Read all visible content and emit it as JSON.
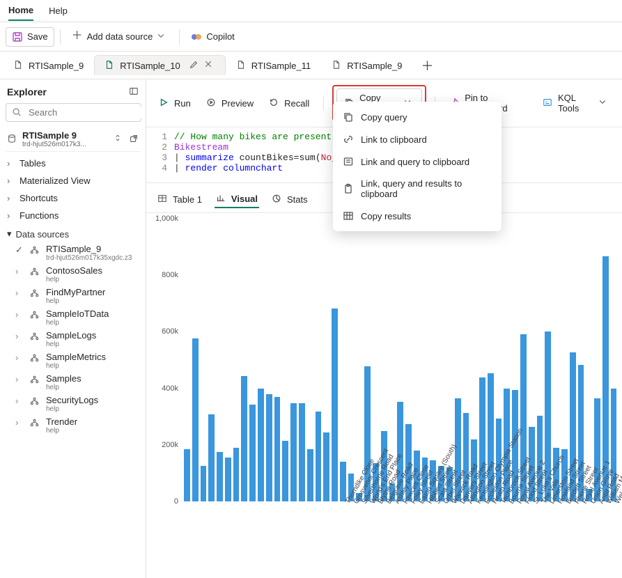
{
  "menu": {
    "home": "Home",
    "help": "Help"
  },
  "toolbar": {
    "save": "Save",
    "add_source": "Add data source",
    "copilot": "Copilot"
  },
  "tabs": [
    {
      "label": "RTISample_9"
    },
    {
      "label": "RTISample_10",
      "active": true
    },
    {
      "label": "RTISample_11"
    },
    {
      "label": "RTISample_9"
    }
  ],
  "actions": {
    "run": "Run",
    "preview": "Preview",
    "recall": "Recall",
    "copy": "Copy query",
    "pin": "Pin to dashboard",
    "kql": "KQL Tools"
  },
  "copy_menu": {
    "copy_query": "Copy query",
    "link": "Link to clipboard",
    "link_query": "Link and query to clipboard",
    "link_query_results": "Link, query and results to clipboard",
    "copy_results": "Copy results"
  },
  "editor": {
    "lines": [
      "1",
      "2",
      "3",
      "4"
    ],
    "line1_comment": "// How many bikes are present",
    "line2_ident": "Bikestream",
    "line3_pipe": "| ",
    "line3_op": "summarize",
    "line3_rest": " countBikes=sum(",
    "line3_col": "No_",
    "line4_pipe": "| ",
    "line4_op": "render",
    "line4_rest": " columnchart"
  },
  "sidebar": {
    "title": "Explorer",
    "search_ph": "Search",
    "db": {
      "name": "RTISample 9",
      "sub": "trd-hjut526m017k3..."
    },
    "sections": [
      "Tables",
      "Materialized View",
      "Shortcuts",
      "Functions"
    ],
    "ds_title": "Data sources",
    "ds": [
      {
        "name": "RTISample_9",
        "sub": "trd-hjut526m017k35xgdc.z3",
        "checked": true
      },
      {
        "name": "ContosoSales",
        "sub": "help"
      },
      {
        "name": "FindMyPartner",
        "sub": "help"
      },
      {
        "name": "SampleIoTData",
        "sub": "help"
      },
      {
        "name": "SampleLogs",
        "sub": "help"
      },
      {
        "name": "SampleMetrics",
        "sub": "help"
      },
      {
        "name": "Samples",
        "sub": "help"
      },
      {
        "name": "SecurityLogs",
        "sub": "help"
      },
      {
        "name": "Trender",
        "sub": "help"
      }
    ]
  },
  "result_tabs": {
    "table": "Table 1",
    "visual": "Visual",
    "stats": "Stats"
  },
  "chart_data": {
    "type": "bar",
    "ylabel": "",
    "xlabel": "",
    "ylim": [
      0,
      1000000
    ],
    "yticks": [
      "0",
      "200k",
      "400k",
      "600k",
      "800k",
      "1,000k"
    ],
    "categories": [
      "Thorndike Close",
      "Grosvenor Crescent",
      "Silverthorne Road",
      "World's End Place",
      "Blythe Road",
      "Belgrave Road",
      "Ashley Place",
      "Fawcett Close",
      "Foley Street",
      "Eaton Square (South)",
      "Hibbert Street",
      "Scala Street",
      "Orbel Street",
      "Warwick Road",
      "Danvers Street",
      "Allington Street",
      "Kensington Olympia Station",
      "Eccleston Place",
      "Heath Road",
      "Tachbrook Street",
      "Bourne Street",
      "Royal Avenue 2",
      "Flood Street",
      "St. Luke's Church",
      "The Vale",
      "Limerston Street",
      "Howland Street",
      "Burdett Street",
      "Phene Street",
      "Royal Avenue 1",
      "Union Grove",
      "Antill Road",
      "William Mor",
      "Wel"
    ],
    "values": [
      190000,
      590000,
      130000,
      315000,
      180000,
      160000,
      195000,
      455000,
      350000,
      410000,
      390000,
      380000,
      220000,
      355000,
      355000,
      190000,
      325000,
      250000,
      700000,
      145000,
      100000,
      30000,
      490000,
      140000,
      255000,
      65000,
      360000,
      280000,
      185000,
      160000,
      150000,
      130000,
      125000,
      375000,
      320000,
      225000,
      450000,
      465000,
      300000,
      410000,
      405000,
      605000,
      270000,
      310000,
      615000,
      195000,
      190000,
      540000,
      495000,
      45000,
      375000,
      890000,
      410000
    ]
  }
}
